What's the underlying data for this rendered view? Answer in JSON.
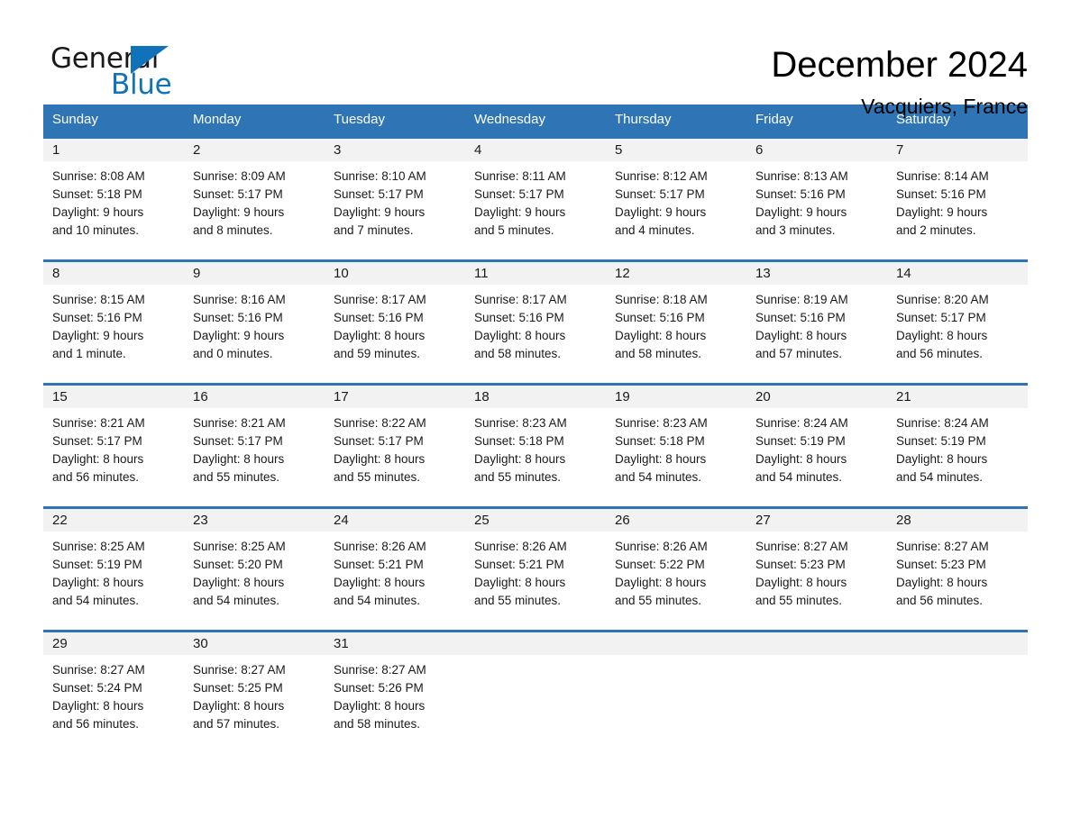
{
  "brand": {
    "name_part1": "General",
    "name_part2": "Blue",
    "triangle_color": "#1072b8",
    "blue_text_color": "#1072b8"
  },
  "header": {
    "month_title": "December 2024",
    "location": "Vacquiers, France",
    "header_bg_color": "#2f75b5",
    "daynum_band_color": "#f2f2f2"
  },
  "calendar": {
    "day_headers": [
      "Sunday",
      "Monday",
      "Tuesday",
      "Wednesday",
      "Thursday",
      "Friday",
      "Saturday"
    ],
    "weeks": [
      [
        {
          "day": "1",
          "sunrise": "Sunrise: 8:08 AM",
          "sunset": "Sunset: 5:18 PM",
          "daylight1": "Daylight: 9 hours",
          "daylight2": "and 10 minutes."
        },
        {
          "day": "2",
          "sunrise": "Sunrise: 8:09 AM",
          "sunset": "Sunset: 5:17 PM",
          "daylight1": "Daylight: 9 hours",
          "daylight2": "and 8 minutes."
        },
        {
          "day": "3",
          "sunrise": "Sunrise: 8:10 AM",
          "sunset": "Sunset: 5:17 PM",
          "daylight1": "Daylight: 9 hours",
          "daylight2": "and 7 minutes."
        },
        {
          "day": "4",
          "sunrise": "Sunrise: 8:11 AM",
          "sunset": "Sunset: 5:17 PM",
          "daylight1": "Daylight: 9 hours",
          "daylight2": "and 5 minutes."
        },
        {
          "day": "5",
          "sunrise": "Sunrise: 8:12 AM",
          "sunset": "Sunset: 5:17 PM",
          "daylight1": "Daylight: 9 hours",
          "daylight2": "and 4 minutes."
        },
        {
          "day": "6",
          "sunrise": "Sunrise: 8:13 AM",
          "sunset": "Sunset: 5:16 PM",
          "daylight1": "Daylight: 9 hours",
          "daylight2": "and 3 minutes."
        },
        {
          "day": "7",
          "sunrise": "Sunrise: 8:14 AM",
          "sunset": "Sunset: 5:16 PM",
          "daylight1": "Daylight: 9 hours",
          "daylight2": "and 2 minutes."
        }
      ],
      [
        {
          "day": "8",
          "sunrise": "Sunrise: 8:15 AM",
          "sunset": "Sunset: 5:16 PM",
          "daylight1": "Daylight: 9 hours",
          "daylight2": "and 1 minute."
        },
        {
          "day": "9",
          "sunrise": "Sunrise: 8:16 AM",
          "sunset": "Sunset: 5:16 PM",
          "daylight1": "Daylight: 9 hours",
          "daylight2": "and 0 minutes."
        },
        {
          "day": "10",
          "sunrise": "Sunrise: 8:17 AM",
          "sunset": "Sunset: 5:16 PM",
          "daylight1": "Daylight: 8 hours",
          "daylight2": "and 59 minutes."
        },
        {
          "day": "11",
          "sunrise": "Sunrise: 8:17 AM",
          "sunset": "Sunset: 5:16 PM",
          "daylight1": "Daylight: 8 hours",
          "daylight2": "and 58 minutes."
        },
        {
          "day": "12",
          "sunrise": "Sunrise: 8:18 AM",
          "sunset": "Sunset: 5:16 PM",
          "daylight1": "Daylight: 8 hours",
          "daylight2": "and 58 minutes."
        },
        {
          "day": "13",
          "sunrise": "Sunrise: 8:19 AM",
          "sunset": "Sunset: 5:16 PM",
          "daylight1": "Daylight: 8 hours",
          "daylight2": "and 57 minutes."
        },
        {
          "day": "14",
          "sunrise": "Sunrise: 8:20 AM",
          "sunset": "Sunset: 5:17 PM",
          "daylight1": "Daylight: 8 hours",
          "daylight2": "and 56 minutes."
        }
      ],
      [
        {
          "day": "15",
          "sunrise": "Sunrise: 8:21 AM",
          "sunset": "Sunset: 5:17 PM",
          "daylight1": "Daylight: 8 hours",
          "daylight2": "and 56 minutes."
        },
        {
          "day": "16",
          "sunrise": "Sunrise: 8:21 AM",
          "sunset": "Sunset: 5:17 PM",
          "daylight1": "Daylight: 8 hours",
          "daylight2": "and 55 minutes."
        },
        {
          "day": "17",
          "sunrise": "Sunrise: 8:22 AM",
          "sunset": "Sunset: 5:17 PM",
          "daylight1": "Daylight: 8 hours",
          "daylight2": "and 55 minutes."
        },
        {
          "day": "18",
          "sunrise": "Sunrise: 8:23 AM",
          "sunset": "Sunset: 5:18 PM",
          "daylight1": "Daylight: 8 hours",
          "daylight2": "and 55 minutes."
        },
        {
          "day": "19",
          "sunrise": "Sunrise: 8:23 AM",
          "sunset": "Sunset: 5:18 PM",
          "daylight1": "Daylight: 8 hours",
          "daylight2": "and 54 minutes."
        },
        {
          "day": "20",
          "sunrise": "Sunrise: 8:24 AM",
          "sunset": "Sunset: 5:19 PM",
          "daylight1": "Daylight: 8 hours",
          "daylight2": "and 54 minutes."
        },
        {
          "day": "21",
          "sunrise": "Sunrise: 8:24 AM",
          "sunset": "Sunset: 5:19 PM",
          "daylight1": "Daylight: 8 hours",
          "daylight2": "and 54 minutes."
        }
      ],
      [
        {
          "day": "22",
          "sunrise": "Sunrise: 8:25 AM",
          "sunset": "Sunset: 5:19 PM",
          "daylight1": "Daylight: 8 hours",
          "daylight2": "and 54 minutes."
        },
        {
          "day": "23",
          "sunrise": "Sunrise: 8:25 AM",
          "sunset": "Sunset: 5:20 PM",
          "daylight1": "Daylight: 8 hours",
          "daylight2": "and 54 minutes."
        },
        {
          "day": "24",
          "sunrise": "Sunrise: 8:26 AM",
          "sunset": "Sunset: 5:21 PM",
          "daylight1": "Daylight: 8 hours",
          "daylight2": "and 54 minutes."
        },
        {
          "day": "25",
          "sunrise": "Sunrise: 8:26 AM",
          "sunset": "Sunset: 5:21 PM",
          "daylight1": "Daylight: 8 hours",
          "daylight2": "and 55 minutes."
        },
        {
          "day": "26",
          "sunrise": "Sunrise: 8:26 AM",
          "sunset": "Sunset: 5:22 PM",
          "daylight1": "Daylight: 8 hours",
          "daylight2": "and 55 minutes."
        },
        {
          "day": "27",
          "sunrise": "Sunrise: 8:27 AM",
          "sunset": "Sunset: 5:23 PM",
          "daylight1": "Daylight: 8 hours",
          "daylight2": "and 55 minutes."
        },
        {
          "day": "28",
          "sunrise": "Sunrise: 8:27 AM",
          "sunset": "Sunset: 5:23 PM",
          "daylight1": "Daylight: 8 hours",
          "daylight2": "and 56 minutes."
        }
      ],
      [
        {
          "day": "29",
          "sunrise": "Sunrise: 8:27 AM",
          "sunset": "Sunset: 5:24 PM",
          "daylight1": "Daylight: 8 hours",
          "daylight2": "and 56 minutes."
        },
        {
          "day": "30",
          "sunrise": "Sunrise: 8:27 AM",
          "sunset": "Sunset: 5:25 PM",
          "daylight1": "Daylight: 8 hours",
          "daylight2": "and 57 minutes."
        },
        {
          "day": "31",
          "sunrise": "Sunrise: 8:27 AM",
          "sunset": "Sunset: 5:26 PM",
          "daylight1": "Daylight: 8 hours",
          "daylight2": "and 58 minutes."
        },
        {
          "day": "",
          "sunrise": "",
          "sunset": "",
          "daylight1": "",
          "daylight2": ""
        },
        {
          "day": "",
          "sunrise": "",
          "sunset": "",
          "daylight1": "",
          "daylight2": ""
        },
        {
          "day": "",
          "sunrise": "",
          "sunset": "",
          "daylight1": "",
          "daylight2": ""
        },
        {
          "day": "",
          "sunrise": "",
          "sunset": "",
          "daylight1": "",
          "daylight2": ""
        }
      ]
    ]
  }
}
